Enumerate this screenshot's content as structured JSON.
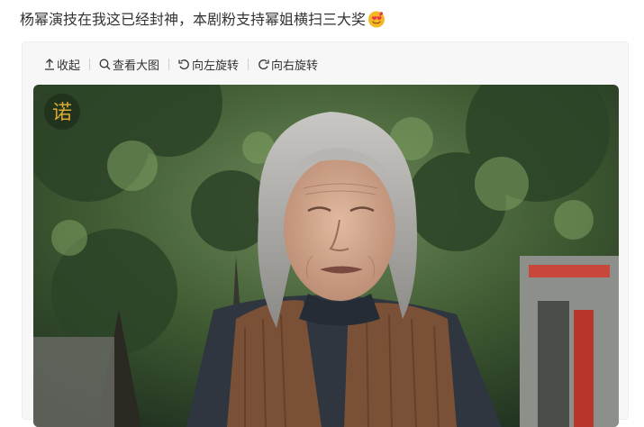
{
  "post": {
    "text": "杨幂演技在我这已经封神，本剧粉支持幂姐横扫三大奖",
    "emoji": "heart-eyes-emoji"
  },
  "toolbar": {
    "collapse_label": "收起",
    "view_large_label": "查看大图",
    "rotate_left_label": "向左旋转",
    "rotate_right_label": "向右旋转"
  },
  "photo": {
    "description_icon": "drama-still-photo",
    "watermark_text": "诺"
  },
  "colors": {
    "text": "#333333",
    "card_bg": "#f7f7f7",
    "emoji_face": "#f5b824",
    "emoji_heart": "#e8314a"
  }
}
